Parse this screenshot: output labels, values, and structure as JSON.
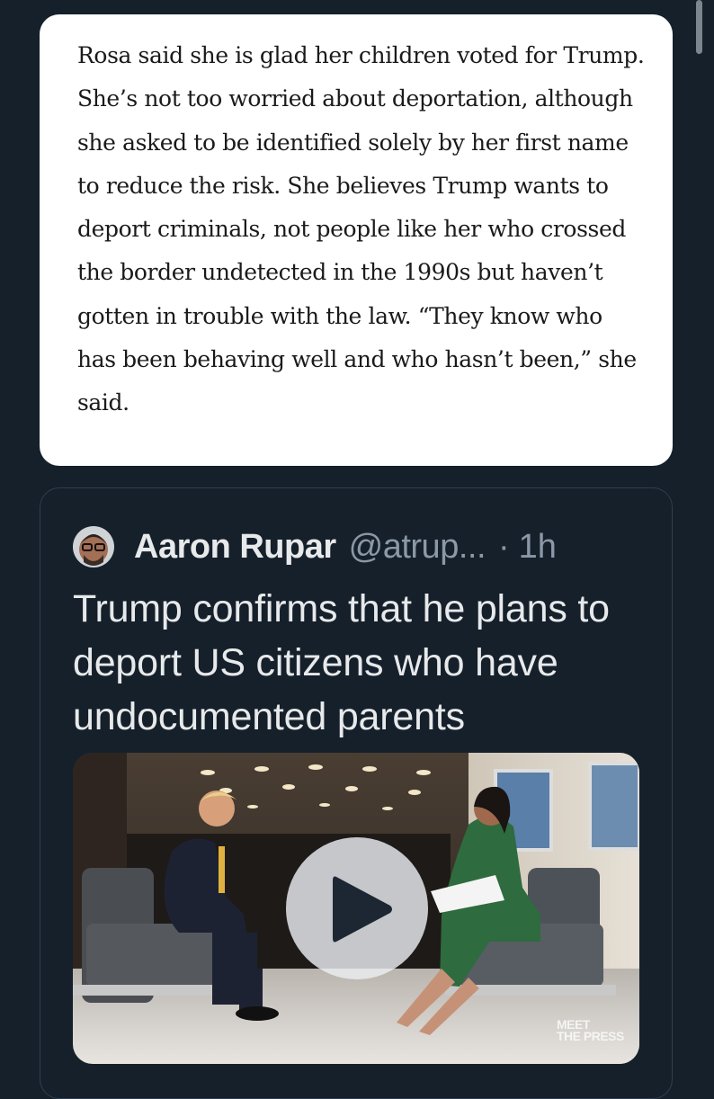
{
  "article": {
    "text": "Rosa said she is glad her children voted for Trump. She’s not too worried about deportation, although she asked to be identified solely by her first name to reduce the risk. She believes Trump wants to deport criminals, not people like her who crossed the border undetected in the 1990s but haven’t gotten in trouble with the law. “They know who has been behaving well and who hasn’t been,” she said."
  },
  "tweet": {
    "display_name": "Aaron Rupar",
    "handle": "@atrup...",
    "separator": "·",
    "timestamp": "1h",
    "text": "Trump confirms that he plans to deport US citizens who have undocumented parents",
    "video": {
      "logo_line1": "MEET",
      "logo_line2": "THE PRESS",
      "play_icon": "play-icon"
    }
  },
  "colors": {
    "background": "#15202b",
    "primary_text": "#e7e9ea",
    "secondary_text": "#8b98a5",
    "card_border": "#2f3e4e"
  }
}
